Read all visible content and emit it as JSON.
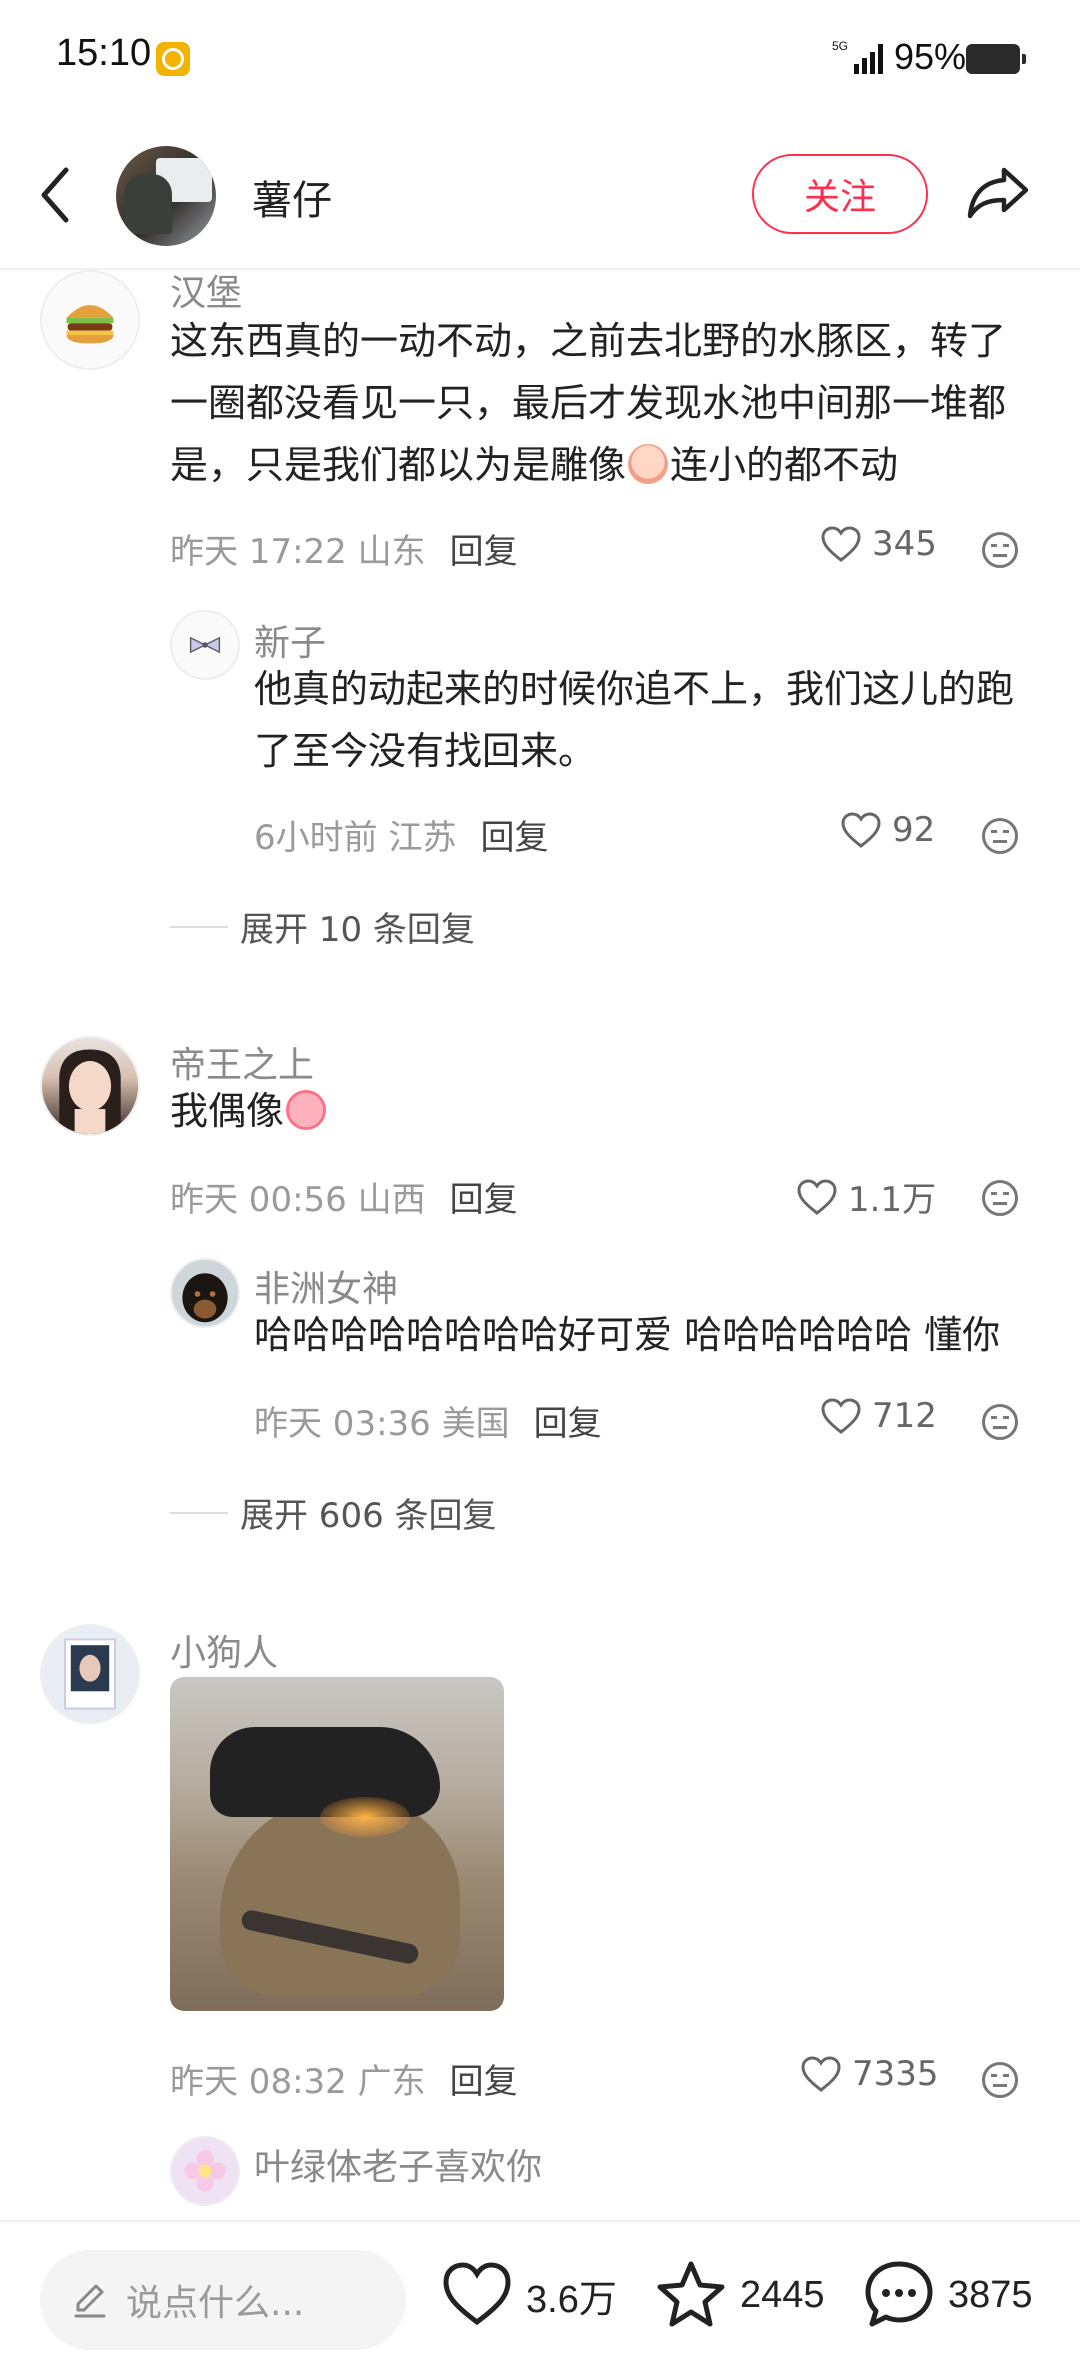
{
  "status_bar": {
    "time": "15:10",
    "network": "5G",
    "battery_percent": "95%"
  },
  "nav": {
    "author_name": "薯仔",
    "follow_label": "关注"
  },
  "comments": [
    {
      "username": "汉堡",
      "avatar_icon": "hamburger-emoji",
      "content_line1": "这东西真的一动不动，之前去北野的水豚区，转了",
      "content_line2": "一圈都没看见一只，最后才发现水池中间那一堆都",
      "content_line3_a": "是，只是我们都以为是雕像",
      "content_line3_b": "连小的都不动",
      "time_location": "昨天 17:22 山东",
      "reply_label": "回复",
      "likes": "345",
      "replies": [
        {
          "username": "新子",
          "content_line1": "他真的动起来的时候你追不上，我们这儿的跑",
          "content_line2": "了至今没有找回来。",
          "time_location": "6小时前 江苏",
          "reply_label": "回复",
          "likes": "92"
        }
      ],
      "expand_label": "展开 10 条回复"
    },
    {
      "username": "帝王之上",
      "content": "我偶像",
      "time_location": "昨天 00:56 山西",
      "reply_label": "回复",
      "likes": "1.1万",
      "replies": [
        {
          "username": "非洲女神",
          "content": "哈哈哈哈哈哈哈哈好可爱 哈哈哈哈哈哈 懂你",
          "time_location": "昨天 03:36 美国",
          "reply_label": "回复",
          "likes": "712"
        }
      ],
      "expand_label": "展开 606 条回复"
    },
    {
      "username": "小狗人",
      "time_location": "昨天 08:32 广东",
      "reply_label": "回复",
      "likes": "7335",
      "replies": [
        {
          "username": "叶绿体老子喜欢你"
        }
      ]
    }
  ],
  "bottom_bar": {
    "input_placeholder": "说点什么...",
    "like_count": "3.6万",
    "collect_count": "2445",
    "comment_count": "3875"
  },
  "colors": {
    "accent": "#ff2e4d",
    "meta_gray": "#9a9a9a",
    "username_gray": "#8a8a8a"
  }
}
